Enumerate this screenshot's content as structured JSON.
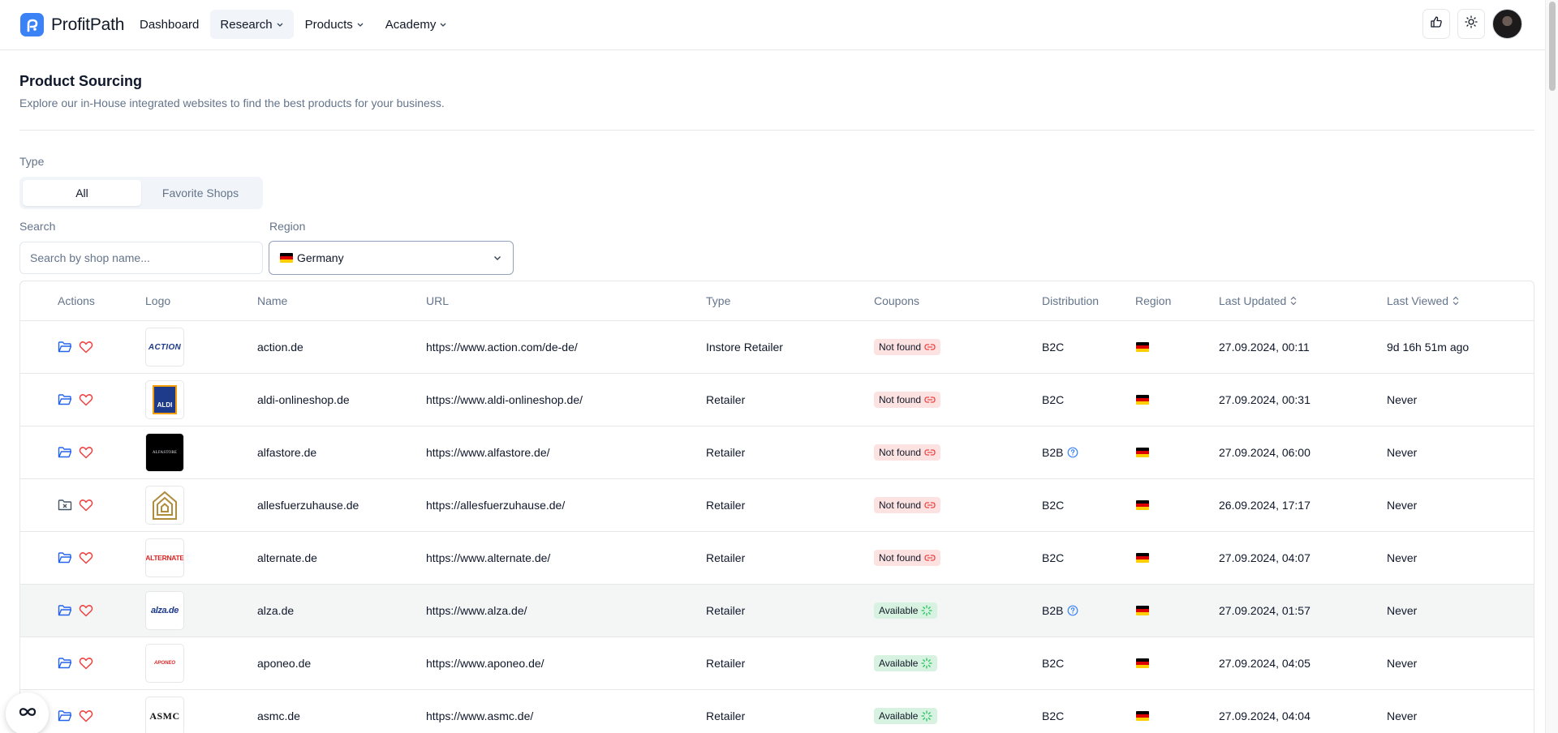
{
  "app": {
    "name": "ProfitPath"
  },
  "nav": [
    {
      "label": "Dashboard"
    },
    {
      "label": "Research"
    },
    {
      "label": "Products"
    },
    {
      "label": "Academy"
    }
  ],
  "header": {
    "title": "Product Sourcing",
    "subtitle": "Explore our in-House integrated websites to find the best products for your business."
  },
  "filters": {
    "type_label": "Type",
    "type_options": [
      "All",
      "Favorite Shops"
    ],
    "type_selected": "All",
    "search_label": "Search",
    "search_placeholder": "Search by shop name...",
    "region_label": "Region",
    "region_value": "Germany"
  },
  "table": {
    "columns": [
      "Actions",
      "Logo",
      "Name",
      "URL",
      "Type",
      "Coupons",
      "Distribution",
      "Region",
      "Last Updated",
      "Last Viewed"
    ],
    "rows": [
      {
        "logo": "ACTION",
        "name": "action.de",
        "url": "https://www.action.com/de-de/",
        "type": "Instore Retailer",
        "coupons": "Not found",
        "distribution": "B2C",
        "last_updated": "27.09.2024, 00:11",
        "last_viewed": "9d 16h 51m ago"
      },
      {
        "logo": "ALDI",
        "name": "aldi-onlineshop.de",
        "url": "https://www.aldi-onlineshop.de/",
        "type": "Retailer",
        "coupons": "Not found",
        "distribution": "B2C",
        "last_updated": "27.09.2024, 00:31",
        "last_viewed": "Never"
      },
      {
        "logo": "ALFASTORE",
        "name": "alfastore.de",
        "url": "https://www.alfastore.de/",
        "type": "Retailer",
        "coupons": "Not found",
        "distribution": "B2B",
        "last_updated": "27.09.2024, 06:00",
        "last_viewed": "Never"
      },
      {
        "logo": "",
        "name": "allesfuerzuhause.de",
        "url": "https://allesfuerzuhause.de/",
        "type": "Retailer",
        "coupons": "Not found",
        "distribution": "B2C",
        "last_updated": "26.09.2024, 17:17",
        "last_viewed": "Never"
      },
      {
        "logo": "ALTERNATE",
        "name": "alternate.de",
        "url": "https://www.alternate.de/",
        "type": "Retailer",
        "coupons": "Not found",
        "distribution": "B2C",
        "last_updated": "27.09.2024, 04:07",
        "last_viewed": "Never"
      },
      {
        "logo": "alza.de",
        "name": "alza.de",
        "url": "https://www.alza.de/",
        "type": "Retailer",
        "coupons": "Available",
        "distribution": "B2B",
        "last_updated": "27.09.2024, 01:57",
        "last_viewed": "Never"
      },
      {
        "logo": "APONEO",
        "name": "aponeo.de",
        "url": "https://www.aponeo.de/",
        "type": "Retailer",
        "coupons": "Available",
        "distribution": "B2C",
        "last_updated": "27.09.2024, 04:05",
        "last_viewed": "Never"
      },
      {
        "logo": "ASMC",
        "name": "asmc.de",
        "url": "https://www.asmc.de/",
        "type": "Retailer",
        "coupons": "Available",
        "distribution": "B2C",
        "last_updated": "27.09.2024, 04:04",
        "last_viewed": "Never"
      }
    ]
  },
  "colors": {
    "brand": "#3b82f6",
    "heart": "#ef4444",
    "folder": "#2563eb",
    "coupon_bad": "#fde2e2",
    "coupon_good": "#d7f2e0"
  }
}
